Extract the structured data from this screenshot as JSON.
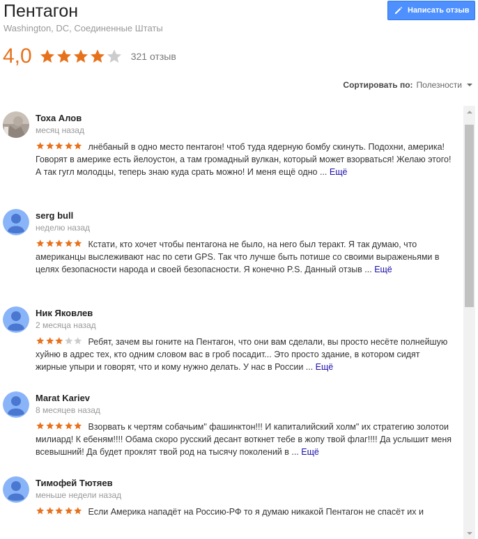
{
  "place": {
    "title": "Пентагон",
    "address": "Washington, DC, Соединенные Штаты"
  },
  "write_button": {
    "label": "Написать отзыв",
    "icon": "pencil-icon"
  },
  "rating": {
    "value": "4,0",
    "stars": 4,
    "reviews_count": "321 отзыв"
  },
  "sort": {
    "label": "Сортировать по:",
    "value": "Полезности"
  },
  "colors": {
    "star": "#e7711b",
    "star_empty": "#cccccc",
    "link": "#1a0dab",
    "button": "#4d90fe",
    "avatar": "#8ab4f8"
  },
  "reviews": [
    {
      "author": "Тоха Алов",
      "date": "месяц назад",
      "stars": 5,
      "text": "лнёбаный в одно место пентагон! чтоб туда ядерную бомбу скинуть. Подохни, америка! Говорят в америке есть йелоустон, а там громадный вулкан, который может взорваться! Желаю этого! А так гугл молодцы, теперь знаю куда срать можно! И меня ещё одно ...",
      "more": "Ещё",
      "avatar": "photo"
    },
    {
      "author": "serg bull",
      "date": "неделю назад",
      "stars": 5,
      "text": "Кстати, кто хочет чтобы пентагона не было, на него был теракт. Я так думаю, что американцы выслеживают нас по сети GPS. Так что лучше быть потише со своими выраженьями в целях безопасности народа и своей безопасности. Я конечно P.S. Данный отзыв ...",
      "more": "Ещё",
      "avatar": "default"
    },
    {
      "author": "Ник Яковлев",
      "date": "2 месяца назад",
      "stars": 3,
      "text": "Ребят,  зачем вы гоните на Пентагон,  что они вам сделали, вы просто несёте полнейшую хуйню в адрес тех, кто одним словом вас в гроб посадит... Это просто здание,  в котором сидят жирные упыри и говорят, что и кому нужно делать. У нас в России ...",
      "more": "Ещё",
      "avatar": "default"
    },
    {
      "author": "Marat Kariev",
      "date": "8 месяцев назад",
      "stars": 5,
      "text": "Взорвать к чертям собачьим\" фашинктон!!! И капиталийский холм\"  их стратегию золотои милиард! К ебеням!!!! Обама скоро русский десант воткнет тебе в жопу твой флаг!!!! Да услышит меня всевышний! Да будет проклят твой род на тысячу поколений в ...",
      "more": "Ещё",
      "avatar": "default"
    },
    {
      "author": "Тимофей Тютяев",
      "date": "меньше недели назад",
      "stars": 5,
      "text": "Если Америка нападёт на Россию-РФ то я думаю никакой Пентагон не спасёт их и",
      "more": "",
      "avatar": "default"
    }
  ]
}
